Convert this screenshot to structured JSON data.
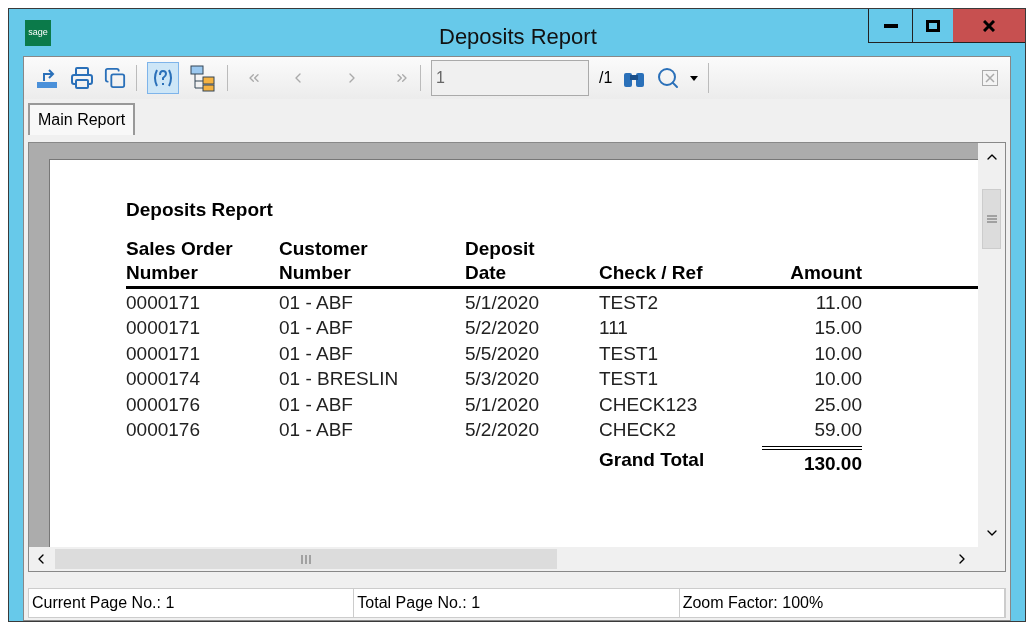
{
  "window": {
    "logo": "sage",
    "title": "Deposits Report"
  },
  "toolbar": {
    "page_field": {
      "value": "1"
    },
    "page_total": "/1"
  },
  "tabs": [
    {
      "label": "Main Report",
      "selected": true
    }
  ],
  "report": {
    "title": "Deposits Report",
    "columns": [
      "Sales Order Number",
      "Customer Number",
      "Deposit Date",
      "Check / Ref",
      "Amount"
    ],
    "rows": [
      {
        "cells": [
          "0000171",
          "01 - ABF",
          "5/1/2020",
          "TEST2",
          "11.00"
        ]
      },
      {
        "cells": [
          "0000171",
          "01 - ABF",
          "5/2/2020",
          "111",
          "15.00"
        ]
      },
      {
        "cells": [
          "0000171",
          "01 - ABF",
          "5/5/2020",
          "TEST1",
          "10.00"
        ]
      },
      {
        "cells": [
          "0000174",
          "01 - BRESLIN",
          "5/3/2020",
          "TEST1",
          "10.00"
        ]
      },
      {
        "cells": [
          "0000176",
          "01 - ABF",
          "5/1/2020",
          "CHECK123",
          "25.00"
        ]
      },
      {
        "cells": [
          "0000176",
          "01 - ABF",
          "5/2/2020",
          "CHECK2",
          "59.00"
        ]
      }
    ],
    "total": {
      "label": "Grand Total",
      "value": "130.00"
    }
  },
  "status_bar": [
    "Current Page No.: 1",
    "Total Page No.: 1",
    "Zoom Factor: 100%"
  ]
}
